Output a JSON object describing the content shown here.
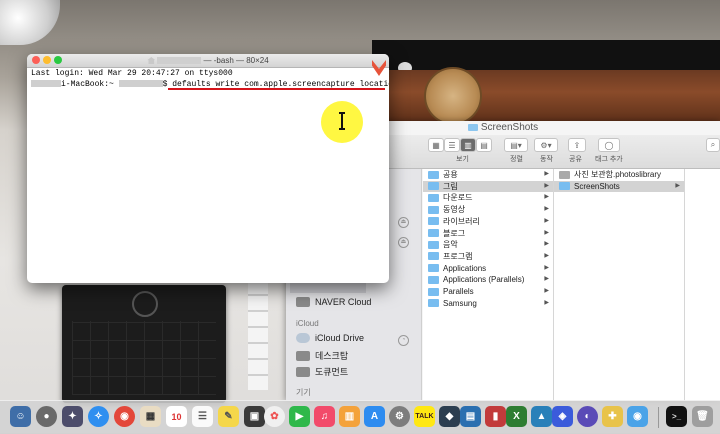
{
  "terminal": {
    "title": "— -bash — 80×24",
    "last_login": "Last login: Wed Mar 29 20:47:27 on ttys000",
    "prompt_host": "i-MacBook:~",
    "prompt_symbol": "$",
    "command": "defaults write com.apple.screencapture location"
  },
  "finder": {
    "title": "ScreenShots",
    "toolbar": {
      "view_label": "보기",
      "arrange_label": "정렬",
      "action_label": "동작",
      "share_label": "공유",
      "tags_label": "태그 추가"
    },
    "sidebar": {
      "item_naver": "NAVER Cloud",
      "icloud_heading": "iCloud",
      "item_icloud_drive": "iCloud Drive",
      "item_desktop": "데스크탑",
      "item_documents": "도큐먼트",
      "devices_heading": "기기"
    },
    "column1": [
      {
        "label": "공용",
        "has_children": true,
        "selected": false
      },
      {
        "label": "그림",
        "has_children": true,
        "selected": true
      },
      {
        "label": "다운로드",
        "has_children": true,
        "selected": false
      },
      {
        "label": "동영상",
        "has_children": true,
        "selected": false
      },
      {
        "label": "라이브러리",
        "has_children": true,
        "selected": false
      },
      {
        "label": "블로그",
        "has_children": true,
        "selected": false
      },
      {
        "label": "음악",
        "has_children": true,
        "selected": false
      },
      {
        "label": "프로그램",
        "has_children": true,
        "selected": false
      },
      {
        "label": "Applications",
        "has_children": true,
        "selected": false
      },
      {
        "label": "Applications (Parallels)",
        "has_children": true,
        "selected": false
      },
      {
        "label": "Parallels",
        "has_children": true,
        "selected": false
      },
      {
        "label": "Samsung",
        "has_children": true,
        "selected": false
      }
    ],
    "column2": [
      {
        "label": "사진 보관함.photoslibrary",
        "has_children": false,
        "selected": false,
        "icon": "photos-library-icon"
      },
      {
        "label": "ScreenShots",
        "has_children": true,
        "selected": true,
        "icon": "folder-icon"
      }
    ]
  },
  "dock": {
    "calendar_day": "10",
    "talk_label": "TALK"
  },
  "colors": {
    "selection_underline": "#d5141b",
    "cursor_highlight": "#fff632",
    "folder_blue": "#78bdf0"
  }
}
